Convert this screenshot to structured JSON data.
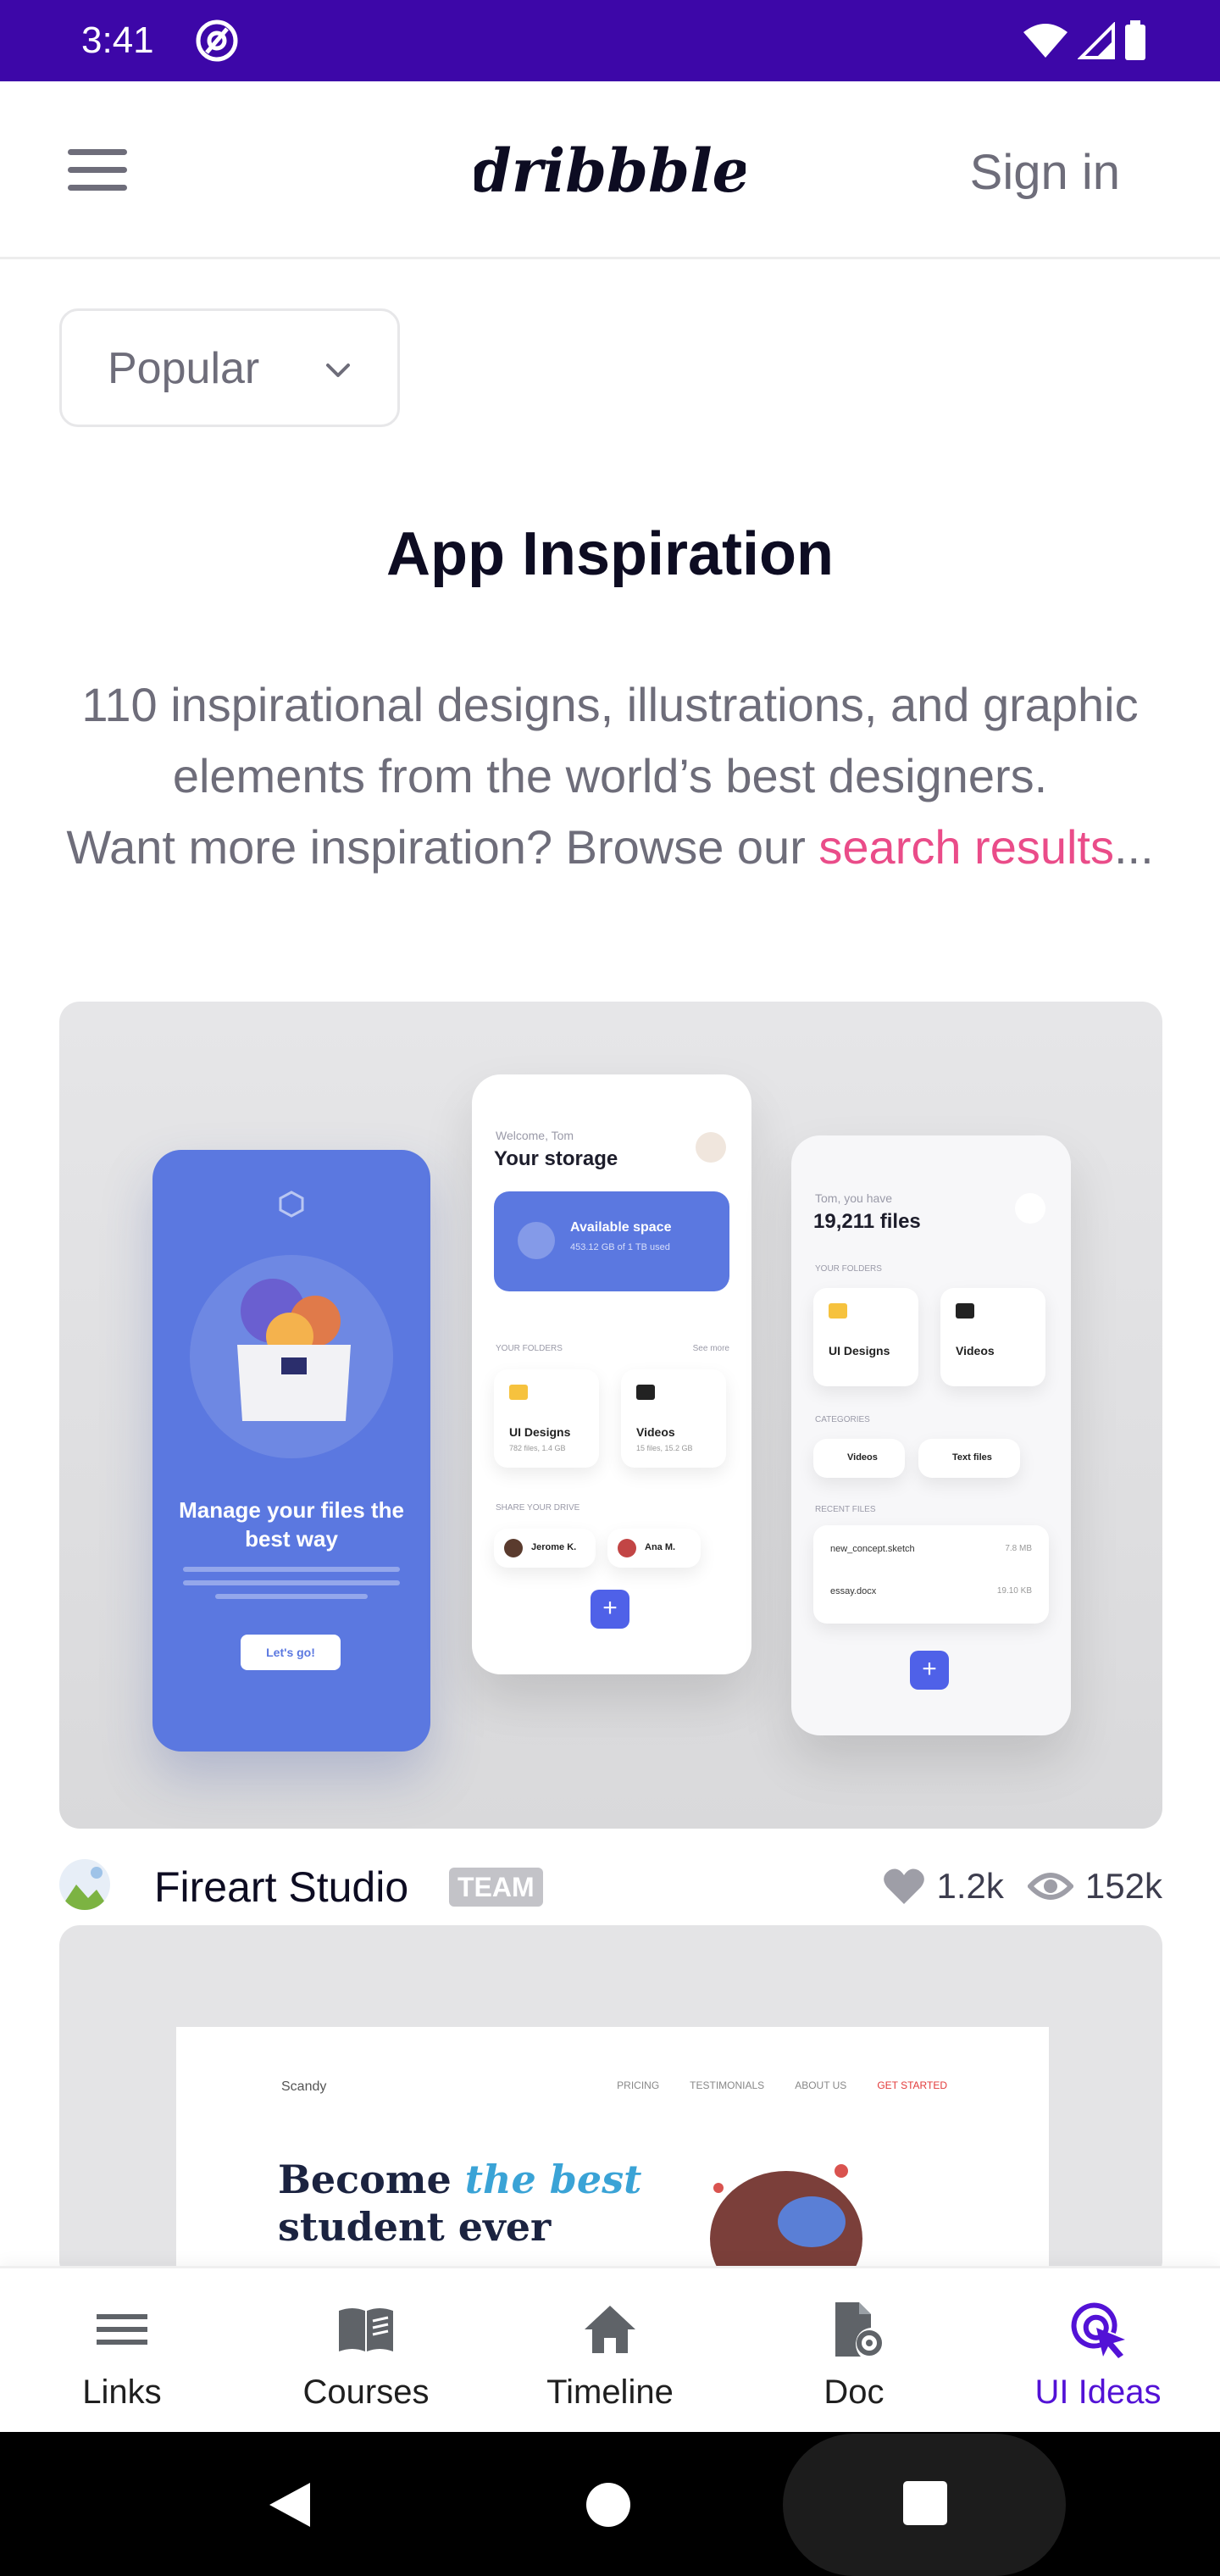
{
  "status_bar": {
    "time": "3:41"
  },
  "header": {
    "brand": "dribbble",
    "sign_in": "Sign in"
  },
  "filter": {
    "selected": "Popular"
  },
  "page": {
    "title": "App Inspiration",
    "description_line1": "110 inspirational designs, illustrations, and graphic",
    "description_line2": "elements from the world’s best designers.",
    "description_line3": "Want more inspiration? Browse our ",
    "link_text": "search results",
    "ellipsis": "..."
  },
  "shots": [
    {
      "mockup": {
        "blue_title": "Manage your files the best way",
        "blue_button": "Let's go!",
        "welcome": "Welcome, Tom",
        "storage_title": "Your storage",
        "available_space": "Available space",
        "available_sub": "453.12 GB of 1 TB used",
        "folders_label": "YOUR FOLDERS",
        "see_more": "See more",
        "folder1": "UI Designs",
        "folder1_sub": "782 files, 1.4 GB",
        "folder2": "Videos",
        "folder2_sub": "15 files, 15.2 GB",
        "share_label": "SHARE YOUR DRIVE",
        "person1": "Jerome K.",
        "person2": "Ana M.",
        "you_have": "Tom, you have",
        "file_count": "19,211 files",
        "categories": "CATEGORIES",
        "cat1": "Videos",
        "cat2": "Text files",
        "recent": "RECENT FILES",
        "recent1": "new_concept.sketch",
        "recent1_size": "7.8 MB",
        "recent2": "essay.docx",
        "recent2_size": "19.10 KB"
      },
      "author": "Fireart Studio",
      "badge": "TEAM",
      "likes": "1.2k",
      "views": "152k"
    },
    {
      "mockup": {
        "brand": "Scandy",
        "nav1": "PRICING",
        "nav2": "TESTIMONIALS",
        "nav3": "ABOUT US",
        "nav_cta": "GET STARTED",
        "headline_part1": "Become ",
        "headline_accent": "the best",
        "headline_part2": "student ever"
      }
    }
  ],
  "bottom_nav": {
    "items": [
      {
        "label": "Links",
        "icon": "list-icon"
      },
      {
        "label": "Courses",
        "icon": "book-icon"
      },
      {
        "label": "Timeline",
        "icon": "home-icon"
      },
      {
        "label": "Doc",
        "icon": "doc-settings-icon"
      },
      {
        "label": "UI Ideas",
        "icon": "cursor-click-icon",
        "active": true
      }
    ]
  },
  "colors": {
    "status_bar": "#3d07a8",
    "accent_pink": "#ea4c89",
    "active_nav": "#5312d6"
  }
}
